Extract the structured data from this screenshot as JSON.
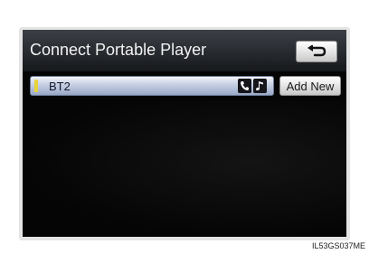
{
  "screen": {
    "title": "Connect Portable Player",
    "back_icon": "return-arrow-icon"
  },
  "devices": [
    {
      "name": "BT2",
      "active": true,
      "services": [
        "phone-icon",
        "music-note-icon"
      ]
    }
  ],
  "buttons": {
    "add_new": "Add New"
  },
  "reference_code": "IL53GS037ME",
  "colors": {
    "active_indicator": "#e6d43a",
    "device_bar": "#c9d2e4",
    "background": "#050505"
  }
}
